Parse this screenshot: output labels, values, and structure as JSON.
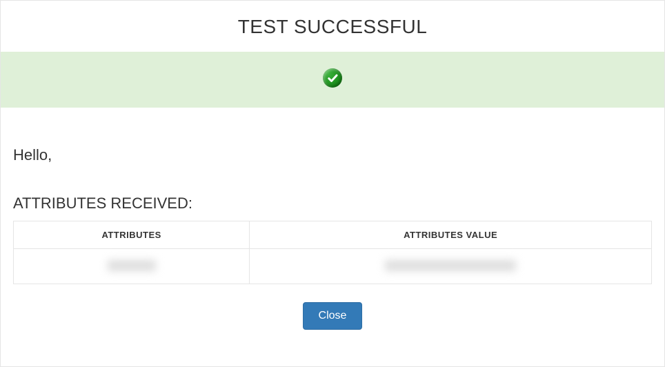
{
  "title": "TEST SUCCESSFUL",
  "greeting": "Hello,",
  "section_label": "ATTRIBUTES RECEIVED:",
  "table": {
    "headers": {
      "attributes": "ATTRIBUTES",
      "value": "ATTRIBUTES VALUE"
    }
  },
  "buttons": {
    "close": "Close"
  },
  "colors": {
    "banner_bg": "#dff0d8",
    "primary_btn": "#337ab7"
  }
}
